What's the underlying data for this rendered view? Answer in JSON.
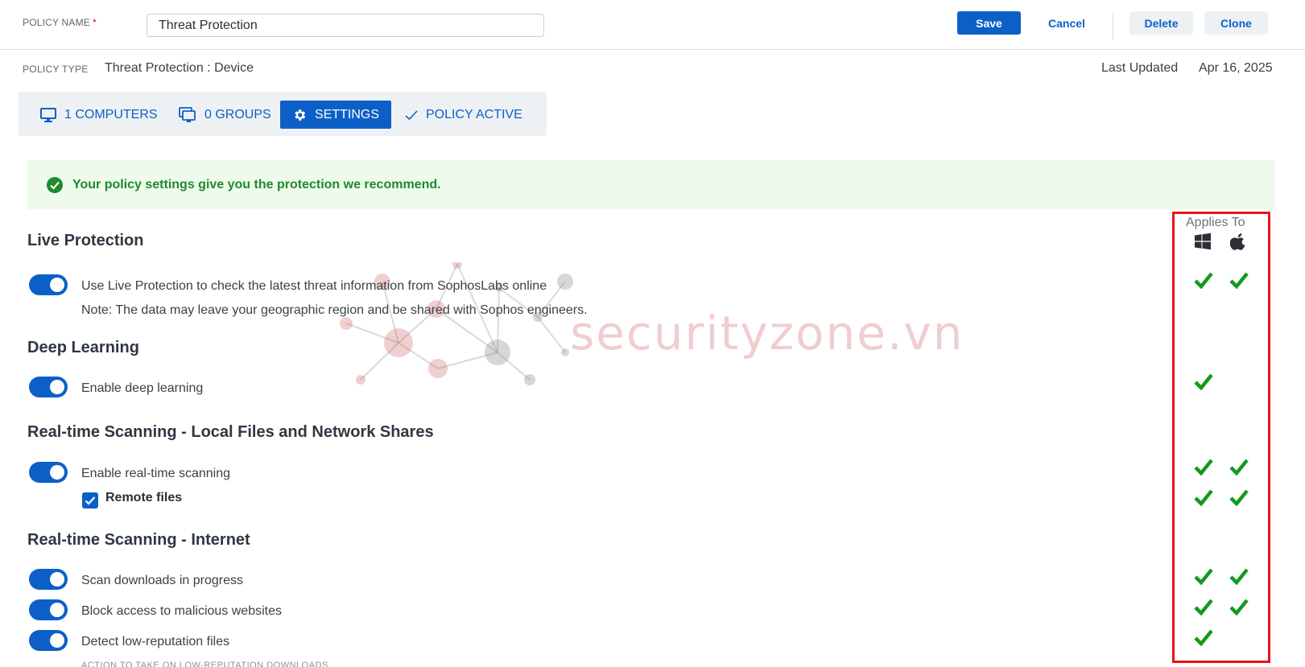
{
  "header": {
    "policy_name_label": "POLICY NAME",
    "required_mark": "*",
    "policy_name_value": "Threat Protection",
    "save_label": "Save",
    "cancel_label": "Cancel",
    "delete_label": "Delete",
    "clone_label": "Clone"
  },
  "meta": {
    "policy_type_label": "POLICY TYPE",
    "policy_type_value": "Threat Protection : Device",
    "last_updated_label": "Last Updated",
    "last_updated_value": "Apr 16, 2025"
  },
  "tabs": [
    {
      "label": "1 COMPUTERS",
      "icon": "monitor-icon"
    },
    {
      "label": "0 GROUPS",
      "icon": "groups-icon"
    },
    {
      "label": "SETTINGS",
      "icon": "gear-icon",
      "selected": true
    },
    {
      "label": "POLICY ACTIVE",
      "icon": "check-icon"
    }
  ],
  "banner": {
    "message": "Your policy settings give you the protection we recommend.",
    "icon": "check-circle-icon"
  },
  "applies_to": {
    "title": "Applies To",
    "platforms": [
      "windows-icon",
      "apple-icon"
    ]
  },
  "sections": {
    "live_protection": {
      "heading": "Live Protection",
      "option": "Use Live Protection to check the latest threat information from SophosLabs online",
      "note": "Note: The data may leave your geographic region and be shared with Sophos engineers.",
      "enabled": true,
      "windows": true,
      "mac": true
    },
    "deep_learning": {
      "heading": "Deep Learning",
      "option": "Enable deep learning",
      "enabled": true,
      "windows": true,
      "mac": false
    },
    "realtime_local": {
      "heading": "Real-time Scanning - Local Files and Network Shares",
      "option": "Enable real-time scanning",
      "enabled": true,
      "sub_option": "Remote files",
      "sub_checked": true
    },
    "realtime_internet": {
      "heading": "Real-time Scanning - Internet",
      "options": [
        {
          "label": "Scan downloads in progress",
          "enabled": true,
          "windows": true,
          "mac": true
        },
        {
          "label": "Block access to malicious websites",
          "enabled": true,
          "windows": true,
          "mac": true
        },
        {
          "label": "Detect low-reputation files",
          "enabled": true,
          "windows": true,
          "mac": false
        }
      ],
      "cutoff_text": "ACTION TO TAKE ON LOW-REPUTATION DOWNLOADS"
    }
  },
  "watermark": {
    "text": "securityzone.vn"
  },
  "colors": {
    "accent": "#0d5fc8",
    "success": "#1f8a2e",
    "banner_bg": "#eefaec",
    "highlight_box": "#e8141e",
    "check": "#129a1e"
  }
}
